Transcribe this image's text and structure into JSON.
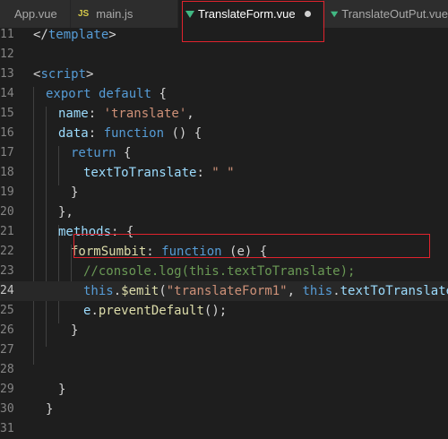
{
  "tabs": [
    {
      "label": "App.vue",
      "icon": "vue-icon",
      "active": false
    },
    {
      "label": "main.js",
      "icon": "js-icon",
      "icon_text": "JS",
      "active": false
    },
    {
      "label": "TranslateForm.vue",
      "icon": "vue-icon",
      "active": true,
      "modified": true
    },
    {
      "label": "TranslateOutPut.vue",
      "icon": "vue-icon",
      "active": false
    }
  ],
  "colors": {
    "vue_icon": "#41b883",
    "annotation_box": "#e0232d",
    "editor_bg": "#1e1e1e"
  },
  "editor": {
    "current_line": "24",
    "lines": [
      {
        "n": "11",
        "segs": [
          {
            "t": "</",
            "c": "pl"
          },
          {
            "t": "template",
            "c": "tag"
          },
          {
            "t": ">",
            "c": "pl"
          }
        ]
      },
      {
        "n": "12",
        "segs": []
      },
      {
        "n": "13",
        "segs": [
          {
            "t": "<",
            "c": "pl"
          },
          {
            "t": "script",
            "c": "tag"
          },
          {
            "t": ">",
            "c": "pl"
          }
        ]
      },
      {
        "n": "14",
        "segs": [
          {
            "t": "export default ",
            "c": "kw"
          },
          {
            "t": "{",
            "c": "pl"
          }
        ]
      },
      {
        "n": "15",
        "segs": [
          {
            "t": "name",
            "c": "prop"
          },
          {
            "t": ": ",
            "c": "pl"
          },
          {
            "t": "'translate'",
            "c": "str"
          },
          {
            "t": ",",
            "c": "pl"
          }
        ]
      },
      {
        "n": "16",
        "segs": [
          {
            "t": "data",
            "c": "prop"
          },
          {
            "t": ": ",
            "c": "pl"
          },
          {
            "t": "function",
            "c": "kw"
          },
          {
            "t": " () {",
            "c": "pl"
          }
        ]
      },
      {
        "n": "17",
        "segs": [
          {
            "t": "return",
            "c": "kw"
          },
          {
            "t": " {",
            "c": "pl"
          }
        ]
      },
      {
        "n": "18",
        "segs": [
          {
            "t": "textToTranslate",
            "c": "prop"
          },
          {
            "t": ": ",
            "c": "pl"
          },
          {
            "t": "\" \"",
            "c": "str"
          }
        ]
      },
      {
        "n": "19",
        "segs": [
          {
            "t": "}",
            "c": "pl"
          }
        ]
      },
      {
        "n": "20",
        "segs": [
          {
            "t": "},",
            "c": "pl"
          }
        ]
      },
      {
        "n": "21",
        "segs": [
          {
            "t": "methods",
            "c": "prop"
          },
          {
            "t": ": {",
            "c": "pl"
          }
        ]
      },
      {
        "n": "22",
        "segs": [
          {
            "t": "formSumbit",
            "c": "fn"
          },
          {
            "t": ": ",
            "c": "pl"
          },
          {
            "t": "function",
            "c": "kw"
          },
          {
            "t": " (e) {",
            "c": "pl"
          }
        ]
      },
      {
        "n": "23",
        "segs": [
          {
            "t": "//console.log(this.textToTranslate);",
            "c": "cm"
          }
        ]
      },
      {
        "n": "24",
        "segs": [
          {
            "t": "this",
            "c": "kw"
          },
          {
            "t": ".",
            "c": "pl"
          },
          {
            "t": "$emit",
            "c": "fn"
          },
          {
            "t": "(",
            "c": "pl"
          },
          {
            "t": "\"translateForm1\"",
            "c": "str"
          },
          {
            "t": ", ",
            "c": "pl"
          },
          {
            "t": "this",
            "c": "kw"
          },
          {
            "t": ".",
            "c": "pl"
          },
          {
            "t": "textToTranslate",
            "c": "prop"
          },
          {
            "t": ");",
            "c": "pl"
          }
        ]
      },
      {
        "n": "25",
        "segs": [
          {
            "t": "e",
            "c": "prop"
          },
          {
            "t": ".",
            "c": "pl"
          },
          {
            "t": "preventDefault",
            "c": "fn"
          },
          {
            "t": "();",
            "c": "pl"
          }
        ]
      },
      {
        "n": "26",
        "segs": [
          {
            "t": "}",
            "c": "pl"
          }
        ]
      },
      {
        "n": "27",
        "segs": []
      },
      {
        "n": "28",
        "segs": []
      },
      {
        "n": "29",
        "segs": [
          {
            "t": "}",
            "c": "pl"
          }
        ]
      },
      {
        "n": "30",
        "segs": [
          {
            "t": "}",
            "c": "pl"
          }
        ]
      },
      {
        "n": "31",
        "segs": []
      }
    ]
  }
}
